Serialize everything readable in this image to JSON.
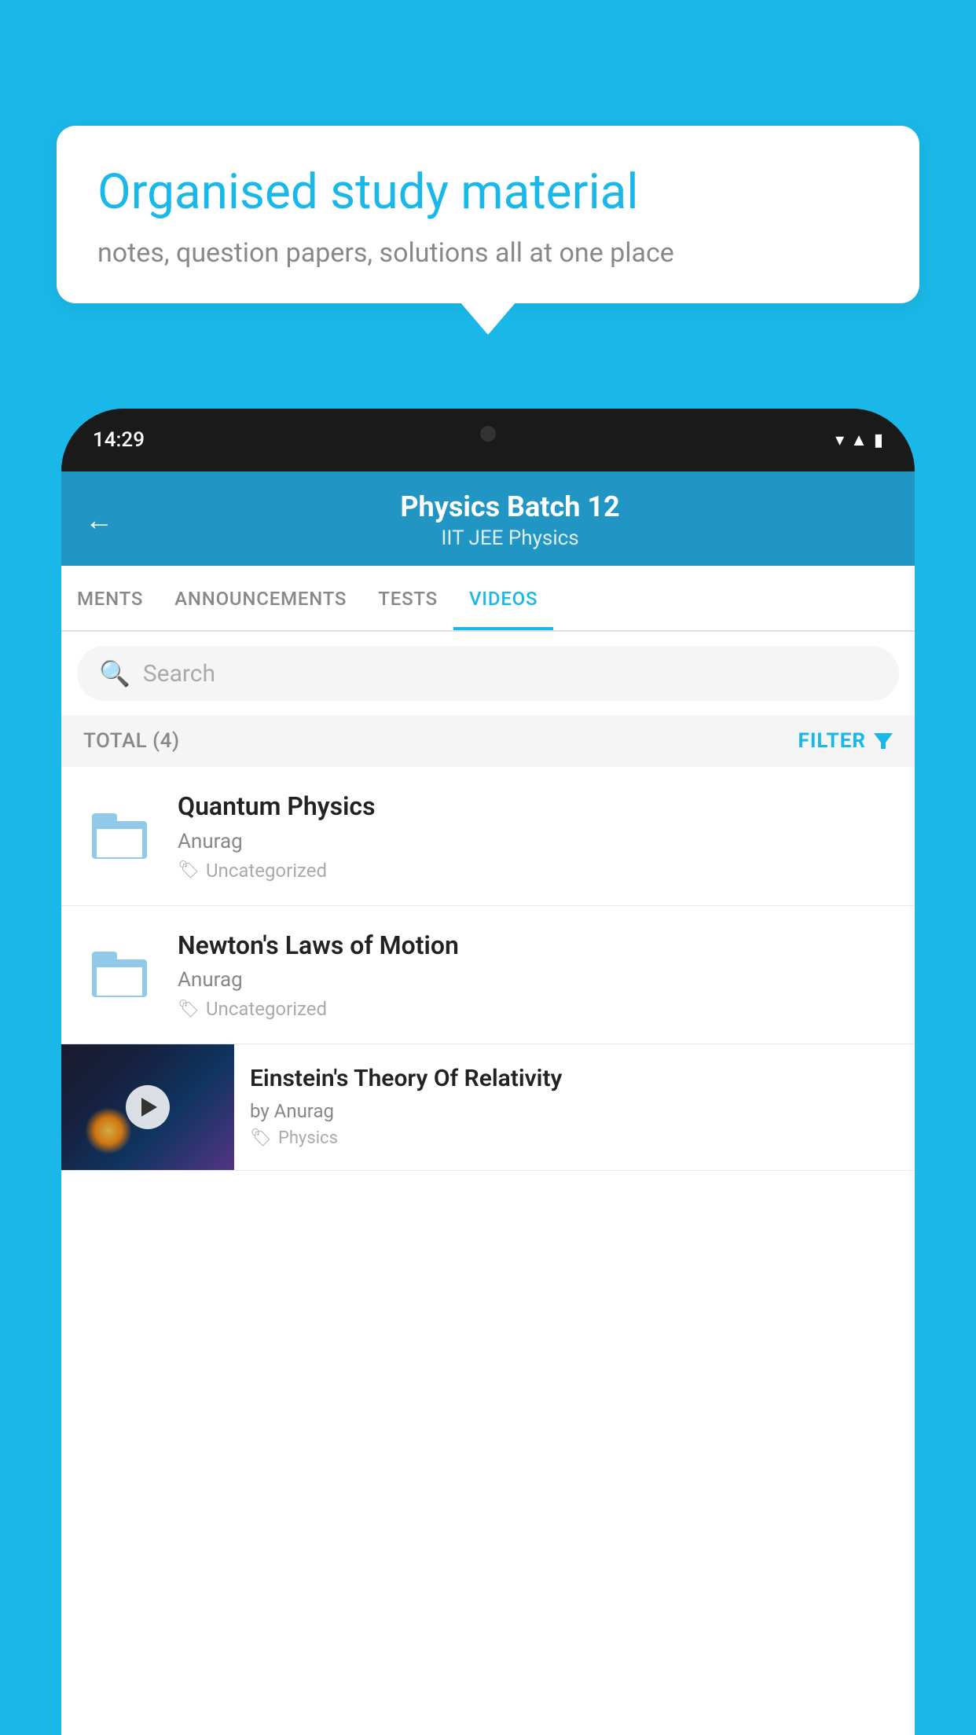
{
  "background_color": "#1ab8e8",
  "speech_bubble": {
    "title": "Organised study material",
    "subtitle": "notes, question papers, solutions all at one place"
  },
  "phone": {
    "time": "14:29",
    "status_icons": [
      "wifi",
      "signal",
      "battery"
    ]
  },
  "app": {
    "header": {
      "back_label": "←",
      "title": "Physics Batch 12",
      "subtitle": "IIT JEE   Physics"
    },
    "tabs": [
      {
        "label": "MENTS",
        "active": false
      },
      {
        "label": "ANNOUNCEMENTS",
        "active": false
      },
      {
        "label": "TESTS",
        "active": false
      },
      {
        "label": "VIDEOS",
        "active": true
      }
    ],
    "search": {
      "placeholder": "Search"
    },
    "filter_bar": {
      "total_label": "TOTAL (4)",
      "filter_label": "FILTER"
    },
    "videos": [
      {
        "id": 1,
        "title": "Quantum Physics",
        "author": "Anurag",
        "tag": "Uncategorized",
        "type": "folder",
        "has_thumbnail": false
      },
      {
        "id": 2,
        "title": "Newton's Laws of Motion",
        "author": "Anurag",
        "tag": "Uncategorized",
        "type": "folder",
        "has_thumbnail": false
      },
      {
        "id": 3,
        "title": "Einstein's Theory Of Relativity",
        "author": "by Anurag",
        "tag": "Physics",
        "type": "video",
        "has_thumbnail": true
      }
    ]
  }
}
